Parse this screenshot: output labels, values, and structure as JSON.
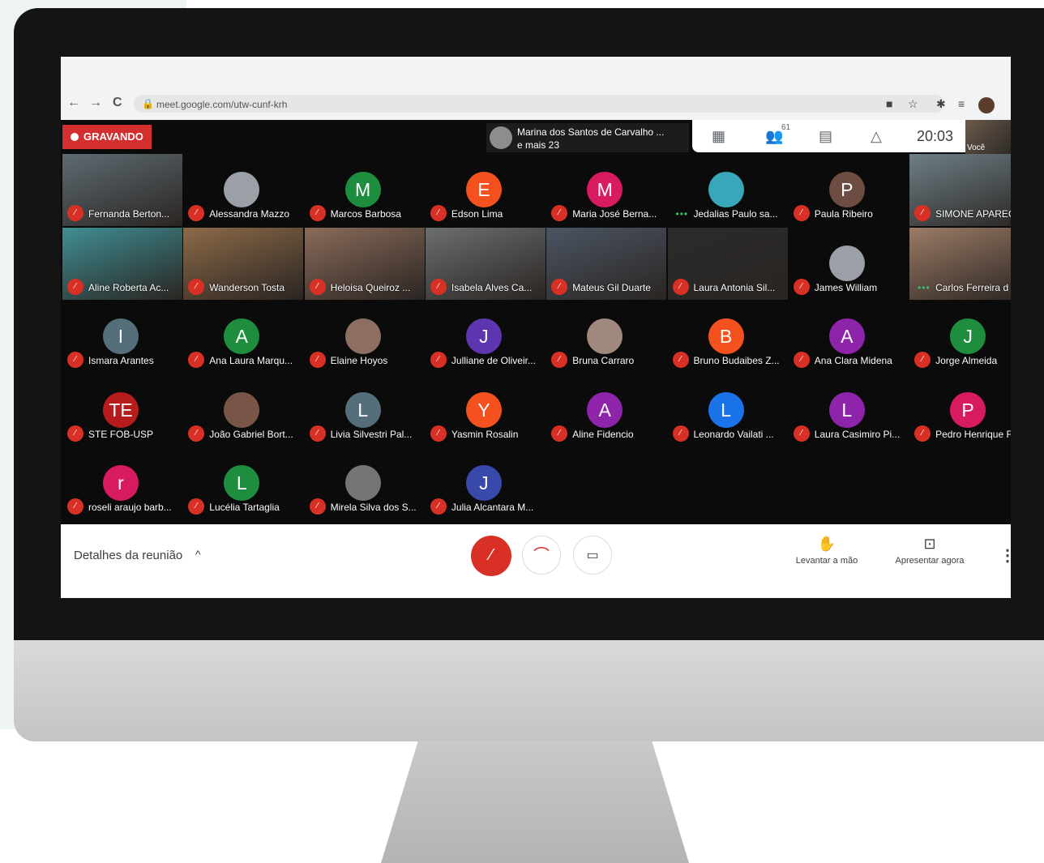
{
  "browser": {
    "nav": {
      "back": "←",
      "forward": "→",
      "reload": "C"
    },
    "url": "meet.google.com/utw-cunf-krh",
    "lock_icon": "🔒",
    "ext_icons": [
      "■",
      "☆",
      "✱",
      "≡"
    ]
  },
  "meet": {
    "recording_label": "GRAVANDO",
    "presenter": {
      "name": "Marina dos Santos de Carvalho ...",
      "more": "e mais 23"
    },
    "topbar": {
      "grid_icon": "▦",
      "people_icon": "👥",
      "people_count": "61",
      "chat_icon": "▤",
      "activities_icon": "△",
      "clock": "20:03"
    },
    "self_label": "Você",
    "tiles": [
      {
        "name": "Fernanda Berton...",
        "type": "video",
        "bg": "#5e6b72"
      },
      {
        "name": "Alessandra Mazzo",
        "type": "avatar",
        "initial": "",
        "color": "#9aa0a6"
      },
      {
        "name": "Marcos Barbosa",
        "type": "avatar",
        "initial": "M",
        "color": "#1e8e3e"
      },
      {
        "name": "Edson Lima",
        "type": "avatar",
        "initial": "E",
        "color": "#f4511e"
      },
      {
        "name": "Maria José Berna...",
        "type": "avatar",
        "initial": "M",
        "color": "#d81b60"
      },
      {
        "name": "Jedalias Paulo sa...",
        "type": "avatar",
        "initial": "",
        "color": "#3aa6b9",
        "speaking": true
      },
      {
        "name": "Paula Ribeiro",
        "type": "avatar",
        "initial": "P",
        "color": "#6d4c41"
      },
      {
        "name": "SIMONE APAREC",
        "type": "video",
        "bg": "#6e7f86"
      },
      {
        "name": "Aline Roberta Ac...",
        "type": "video",
        "bg": "#3f8e93"
      },
      {
        "name": "Wanderson Tosta",
        "type": "video",
        "bg": "#8c6a48"
      },
      {
        "name": "Heloisa Queiroz ...",
        "type": "video",
        "bg": "#8a6b5a"
      },
      {
        "name": "Isabela Alves Ca...",
        "type": "video",
        "bg": "#6b6e70"
      },
      {
        "name": "Mateus Gil Duarte",
        "type": "video",
        "bg": "#4b5563"
      },
      {
        "name": "Laura Antonia Sil...",
        "type": "video",
        "bg": "#2b2b2b"
      },
      {
        "name": "James William",
        "type": "avatar",
        "initial": "",
        "color": "#9aa0a6"
      },
      {
        "name": "Carlos Ferreira d",
        "type": "video",
        "bg": "#9b7b66",
        "speaking": true
      },
      {
        "name": "Ismara Arantes",
        "type": "avatar",
        "initial": "I",
        "color": "#546e7a"
      },
      {
        "name": "Ana Laura Marqu...",
        "type": "avatar",
        "initial": "A",
        "color": "#1e8e3e"
      },
      {
        "name": "Elaine Hoyos",
        "type": "avatar",
        "initial": "",
        "color": "#8d6e63"
      },
      {
        "name": "Julliane de Oliveir...",
        "type": "avatar",
        "initial": "J",
        "color": "#5e35b1"
      },
      {
        "name": "Bruna Carraro",
        "type": "avatar",
        "initial": "",
        "color": "#a1887f"
      },
      {
        "name": "Bruno Budaibes Z...",
        "type": "avatar",
        "initial": "B",
        "color": "#f4511e"
      },
      {
        "name": "Ana Clara Midena",
        "type": "avatar",
        "initial": "A",
        "color": "#8e24aa"
      },
      {
        "name": "Jorge Almeida",
        "type": "avatar",
        "initial": "J",
        "color": "#1e8e3e"
      },
      {
        "name": "STE FOB-USP",
        "type": "avatar",
        "initial": "TE",
        "color": "#b71c1c"
      },
      {
        "name": "João Gabriel Bort...",
        "type": "avatar",
        "initial": "",
        "color": "#795548"
      },
      {
        "name": "Livia Silvestri Pal...",
        "type": "avatar",
        "initial": "L",
        "color": "#546e7a"
      },
      {
        "name": "Yasmin Rosalin",
        "type": "avatar",
        "initial": "Y",
        "color": "#f4511e"
      },
      {
        "name": "Aline Fidencio",
        "type": "avatar",
        "initial": "A",
        "color": "#8e24aa"
      },
      {
        "name": "Leonardo Vailati ...",
        "type": "avatar",
        "initial": "L",
        "color": "#1a73e8"
      },
      {
        "name": "Laura Casimiro Pi...",
        "type": "avatar",
        "initial": "L",
        "color": "#8e24aa"
      },
      {
        "name": "Pedro Henrique F",
        "type": "avatar",
        "initial": "P",
        "color": "#d81b60"
      },
      {
        "name": "roseli araujo barb...",
        "type": "avatar",
        "initial": "r",
        "color": "#d81b60"
      },
      {
        "name": "Lucélia Tartaglia",
        "type": "avatar",
        "initial": "L",
        "color": "#1e8e3e"
      },
      {
        "name": "Mirela Silva dos S...",
        "type": "avatar",
        "initial": "",
        "color": "#757575"
      },
      {
        "name": "Julia Alcantara M...",
        "type": "avatar",
        "initial": "J",
        "color": "#3949ab"
      }
    ]
  },
  "bottom": {
    "details_label": "Detalhes da reunião",
    "details_caret": "^",
    "mic_icon": "⁄",
    "end_icon": "⌒",
    "cam_icon": "▭",
    "raise_hand_icon": "✋",
    "raise_hand_label": "Levantar a mão",
    "present_icon": "⊡",
    "present_label": "Apresentar agora",
    "more_icon": "⋮",
    "tile_mic_icon": "⁄",
    "speaking_icon": "•••"
  }
}
